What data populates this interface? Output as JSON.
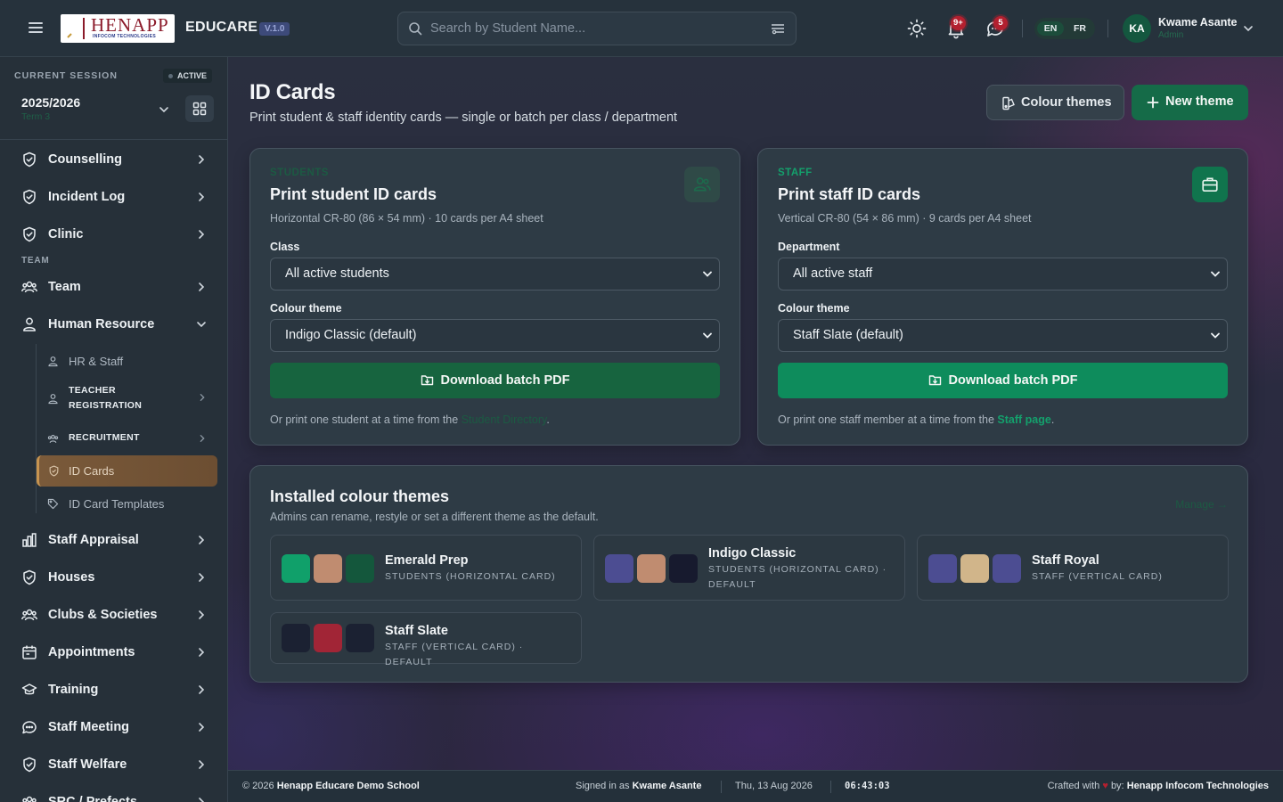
{
  "header": {
    "brand": "EDUCARE",
    "version": "V.1.0",
    "logo_text": "HENAPP",
    "logo_subtext": "INFOCOM TECHNOLOGIES",
    "search_placeholder": "Search by Student Name...",
    "notification_count": "9+",
    "message_count": "5",
    "lang_en": "EN",
    "lang_fr": "FR",
    "user_initials": "KA",
    "user_name": "Kwame Asante",
    "user_role": "Admin"
  },
  "sidebar": {
    "session_label": "CURRENT SESSION",
    "session_status": "ACTIVE",
    "session_year": "2025/2026",
    "session_term": "Term 3",
    "items_top": [
      {
        "label": "Counselling",
        "icon": "shield-icon"
      },
      {
        "label": "Incident Log",
        "icon": "shield-icon"
      },
      {
        "label": "Clinic",
        "icon": "shield-icon"
      }
    ],
    "section_team": "TEAM",
    "team": {
      "label": "Team",
      "icon": "users-icon"
    },
    "hr": {
      "label": "Human Resource",
      "icon": "user-icon"
    },
    "hr_sub": [
      {
        "label": "HR & Staff",
        "icon": "user-icon"
      },
      {
        "label": "TEACHER REGISTRATION",
        "icon": "user-icon"
      },
      {
        "label": "RECRUITMENT",
        "icon": "users-icon"
      },
      {
        "label": "ID Cards",
        "icon": "shield-icon"
      },
      {
        "label": "ID Card Templates",
        "icon": "tag-icon"
      }
    ],
    "items_bottom": [
      {
        "label": "Staff Appraisal",
        "icon": "bar-chart-icon"
      },
      {
        "label": "Houses",
        "icon": "shield-icon"
      },
      {
        "label": "Clubs & Societies",
        "icon": "users-icon"
      },
      {
        "label": "Appointments",
        "icon": "calendar-icon"
      },
      {
        "label": "Training",
        "icon": "graduation-icon"
      },
      {
        "label": "Staff Meeting",
        "icon": "chat-icon"
      },
      {
        "label": "Staff Welfare",
        "icon": "shield-icon"
      },
      {
        "label": "SRC / Prefects",
        "icon": "users-icon"
      }
    ]
  },
  "page": {
    "title": "ID Cards",
    "subtitle": "Print student & staff identity cards — single or batch per class / department",
    "btn_themes": "Colour themes",
    "btn_new": "New theme"
  },
  "student_card": {
    "kicker": "STUDENTS",
    "title": "Print student ID cards",
    "desc": "Horizontal CR-80 (86 × 54 mm) · 10 cards per A4 sheet",
    "class_label": "Class",
    "class_value": "All active students",
    "theme_label": "Colour theme",
    "theme_value": "Indigo Classic (default)",
    "download": "Download batch PDF",
    "note_prefix": "Or print one student at a time from the",
    "note_link": "Student Directory",
    "note_suffix": "."
  },
  "staff_card": {
    "kicker": "STAFF",
    "title": "Print staff ID cards",
    "desc": "Vertical CR-80 (54 × 86 mm) · 9 cards per A4 sheet",
    "dept_label": "Department",
    "dept_value": "All active staff",
    "theme_label": "Colour theme",
    "theme_value": "Staff Slate (default)",
    "download": "Download batch PDF",
    "note_prefix": "Or print one staff member at a time from the",
    "note_link": "Staff page",
    "note_suffix": "."
  },
  "themes": {
    "title": "Installed colour themes",
    "desc": "Admins can rename, restyle or set a different theme as the default.",
    "manage": "Manage →",
    "list": [
      {
        "name": "Emerald Prep",
        "meta": "STUDENTS (HORIZONTAL CARD)",
        "colors": [
          "#10a06a",
          "#c08c70",
          "#14573c"
        ]
      },
      {
        "name": "Indigo Classic",
        "meta": "STUDENTS (HORIZONTAL CARD) · DEFAULT",
        "colors": [
          "#4c4d92",
          "#c08c70",
          "#171a2e"
        ]
      },
      {
        "name": "Staff Royal",
        "meta": "STAFF (VERTICAL CARD)",
        "colors": [
          "#4c4d92",
          "#d1b58a",
          "#4c4d92"
        ]
      },
      {
        "name": "Staff Slate",
        "meta": "STAFF (VERTICAL CARD) · DEFAULT",
        "colors": [
          "#1b2132",
          "#a12536",
          "#1b2132"
        ]
      }
    ]
  },
  "footer": {
    "copyright_prefix": "© 2026",
    "school": "Henapp Educare Demo School",
    "signed_prefix": "Signed in as",
    "signed_user": "Kwame Asante",
    "date": "Thu, 13 Aug 2026",
    "time": "06:43:03",
    "crafted_prefix": "Crafted with",
    "crafted_suffix": "by:",
    "company": "Henapp Infocom Technologies"
  },
  "colors": {
    "accent_green": "#0e8c5c",
    "accent_green_dark": "#156b48",
    "active_bronze": "#7a5a3a",
    "badge_red": "#b3202f"
  }
}
